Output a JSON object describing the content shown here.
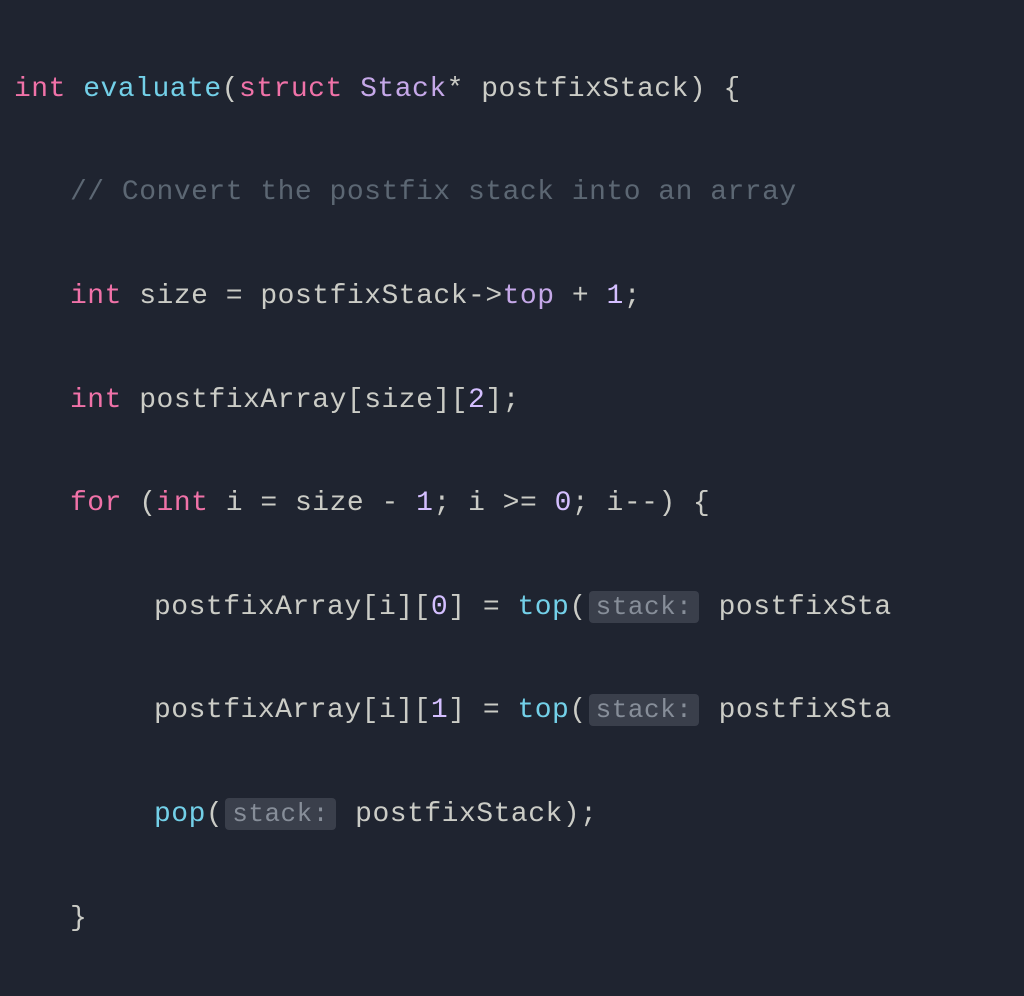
{
  "lines": {
    "l1": {
      "kw_int": "int",
      "func": "evaluate",
      "paren_open": "(",
      "kw_struct": "struct",
      "type_stack": "Stack",
      "star": "*",
      "param": "postfixStack",
      "paren_close": ")",
      "brace_open": " {"
    },
    "l2": {
      "comment": "// Convert the postfix stack into an array"
    },
    "l3": {
      "kw_int": "int",
      "ident_size": "size",
      "eq": " = ",
      "ident_ps": "postfixStack",
      "arrow": "->",
      "prop_top": "top",
      "plus": " + ",
      "num_1": "1",
      "semi": ";"
    },
    "l4": {
      "kw_int": "int",
      "ident_arr": "postfixArray",
      "br_open1": "[",
      "ident_size": "size",
      "br_close1": "]",
      "br_open2": "[",
      "num_2": "2",
      "br_close2": "]",
      "semi": ";"
    },
    "l5": {
      "kw_for": "for",
      "paren_open": " (",
      "kw_int": "int",
      "ident_i": "i",
      "eq": " = ",
      "ident_size": "size",
      "minus": " - ",
      "num_1": "1",
      "semi1": "; ",
      "ident_i2": "i",
      "gte": " >= ",
      "num_0": "0",
      "semi2": "; ",
      "ident_i3": "i",
      "dec": "--",
      "paren_close": ")",
      "brace_open": " {"
    },
    "l6": {
      "ident_arr": "postfixArray",
      "br_open1": "[",
      "ident_i": "i",
      "br_close1": "]",
      "br_open2": "[",
      "num_0": "0",
      "br_close2": "]",
      "eq": " = ",
      "func_top": "top",
      "paren_open": "(",
      "hint": "stack:",
      "ident_ps": "postfixSta"
    },
    "l7": {
      "ident_arr": "postfixArray",
      "br_open1": "[",
      "ident_i": "i",
      "br_close1": "]",
      "br_open2": "[",
      "num_1": "1",
      "br_close2": "]",
      "eq": " = ",
      "func_top": "top",
      "paren_open": "(",
      "hint": "stack:",
      "ident_ps": "postfixSta"
    },
    "l8": {
      "func_pop": "pop",
      "paren_open": "(",
      "hint": "stack:",
      "ident_ps": "postfixStack",
      "paren_close": ")",
      "semi": ";"
    },
    "l9": {
      "brace_close": "}"
    }
  }
}
